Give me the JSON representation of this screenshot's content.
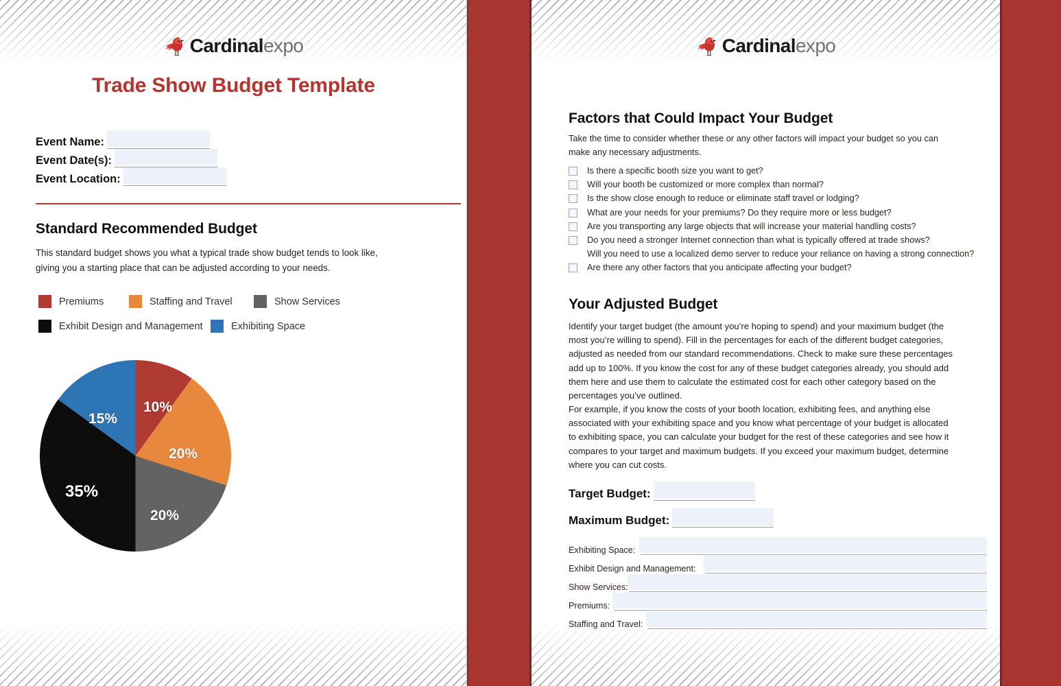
{
  "brand": {
    "name_bold": "Cardinal",
    "name_light": "expo",
    "logo_icon": "cardinal-bird-icon",
    "accent_red": "#B4352F",
    "band_red": "#A93530"
  },
  "left_page": {
    "title": "Trade Show Budget Template",
    "fields": [
      {
        "label": "Event Name:",
        "value": "",
        "placeholder": ""
      },
      {
        "label": "Event Date(s):",
        "value": "",
        "placeholder": ""
      },
      {
        "label": "Event Location:",
        "value": "",
        "placeholder": ""
      }
    ],
    "section": {
      "heading": "Standard Recommended Budget",
      "description": "This standard budget shows you what a typical trade show budget tends to look like, giving you a starting place that can be adjusted according to your needs."
    }
  },
  "right_page": {
    "factors": {
      "heading": "Factors that Could Impact Your Budget",
      "description": "Take the time to consider whether these or any other factors will impact your budget so you can make any necessary adjustments.",
      "items": [
        {
          "text": "Is there a specific booth size you want to get?",
          "has_checkbox": true
        },
        {
          "text": "Will your booth be customized or more complex than normal?",
          "has_checkbox": true
        },
        {
          "text": "Is the show close enough to reduce or eliminate staff travel or lodging?",
          "has_checkbox": true
        },
        {
          "text": "What are your needs for your premiums? Do they require more or less budget?",
          "has_checkbox": true
        },
        {
          "text": "Are you transporting any large objects that will increase your material handling costs?",
          "has_checkbox": true
        },
        {
          "text": "Do you need a stronger Internet connection than what is typically offered at trade shows?",
          "has_checkbox": true
        },
        {
          "text": "Will you need to use a localized demo server to reduce your reliance on having a strong connection?",
          "has_checkbox": false
        },
        {
          "text": "Are there any other factors that you anticipate affecting your budget?",
          "has_checkbox": true
        }
      ]
    },
    "adjusted": {
      "heading": "Your Adjusted Budget",
      "paragraph_1": "Identify your target budget (the amount you’re hoping to spend) and your maximum budget (the most you’re willing to spend). Fill in the percentages for each of the different budget categories, adjusted as needed from our standard recommendations. Check to make sure these percentages add up to 100%. If you know the cost for any of these budget categories already, you should add them here and use them to calculate the estimated cost for each other category based on the percentages you’ve outlined.",
      "paragraph_2": "For example, if you know the costs of your booth location, exhibiting fees, and anything else associated with your exhibiting space and you know what percentage of your budget is allocated to exhibiting space, you can calculate your budget for the rest of these categories and see how it compares to your target and maximum budgets. If you exceed your maximum budget, determine where you can cut costs.",
      "budget_fields": [
        {
          "label": "Target Budget:",
          "value": "",
          "placeholder": ""
        },
        {
          "label": "Maximum Budget:",
          "value": "",
          "placeholder": ""
        }
      ],
      "category_fields": [
        {
          "label": "Exhibiting Space:",
          "value": "",
          "placeholder": ""
        },
        {
          "label": "Exhibit Design and Management:",
          "value": "",
          "placeholder": ""
        },
        {
          "label": "Show Services:",
          "value": "",
          "placeholder": ""
        },
        {
          "label": "Premiums:",
          "value": "",
          "placeholder": ""
        },
        {
          "label": "Staffing and Travel:",
          "value": "",
          "placeholder": ""
        }
      ]
    }
  },
  "chart_data": {
    "type": "pie",
    "title": "Standard Recommended Budget",
    "categories": [
      "Premiums",
      "Staffing and Travel",
      "Show Services",
      "Exhibit Design and Management",
      "Exhibiting Space"
    ],
    "values": [
      10,
      20,
      20,
      35,
      15
    ],
    "labels": [
      "10%",
      "20%",
      "20%",
      "35%",
      "15%"
    ],
    "colors": [
      "#AE3A32",
      "#E8883C",
      "#636363",
      "#0D0D0D",
      "#2E75B6"
    ],
    "unit": "percent",
    "start_angle_deg": 0,
    "direction": "clockwise",
    "legend_position": "above-chart",
    "grid": false,
    "legend": [
      {
        "label": "Premiums",
        "color": "#AE3A32"
      },
      {
        "label": "Staffing and Travel",
        "color": "#E8883C"
      },
      {
        "label": "Show Services",
        "color": "#636363"
      },
      {
        "label": "Exhibit Design and Management",
        "color": "#0D0D0D"
      },
      {
        "label": "Exhibiting Space",
        "color": "#2E75B6"
      }
    ]
  }
}
